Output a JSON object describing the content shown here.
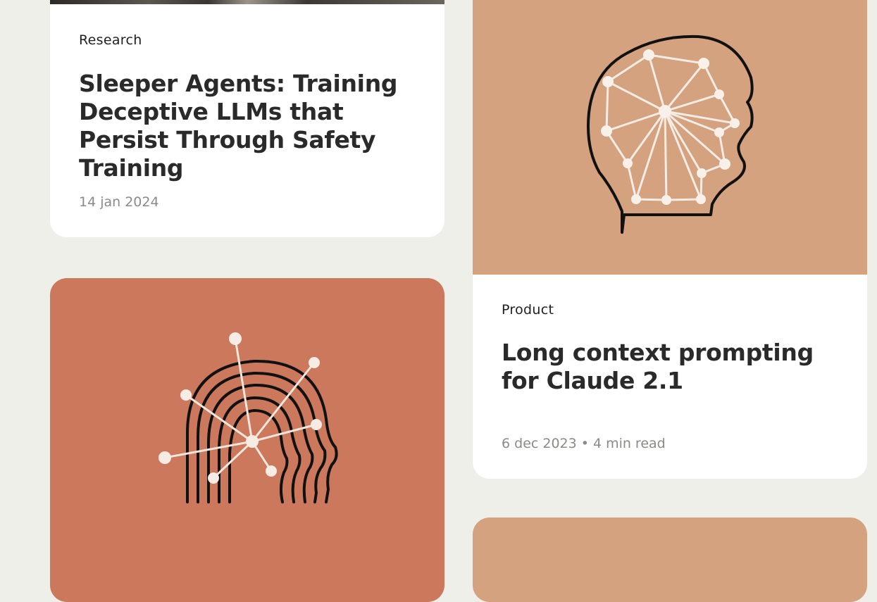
{
  "cards": [
    {
      "category": "Research",
      "title": "Sleeper Agents: Training Deceptive LLMs that Persist Through Safety Training",
      "date": "14 jan 2024"
    },
    {
      "category": "Product",
      "title": "Long context prompting for Claude 2.1",
      "date": "6 dec 2023",
      "separator": "•",
      "read_time": "4 min read"
    }
  ],
  "colors": {
    "page_background": "#efefea",
    "card_background": "#ffffff",
    "tan_illustration": "#d4a27f",
    "terracotta_illustration": "#cc785c",
    "meta_text": "#8a8a86"
  },
  "icons": [
    "head-network-illustration",
    "head-rays-illustration"
  ]
}
